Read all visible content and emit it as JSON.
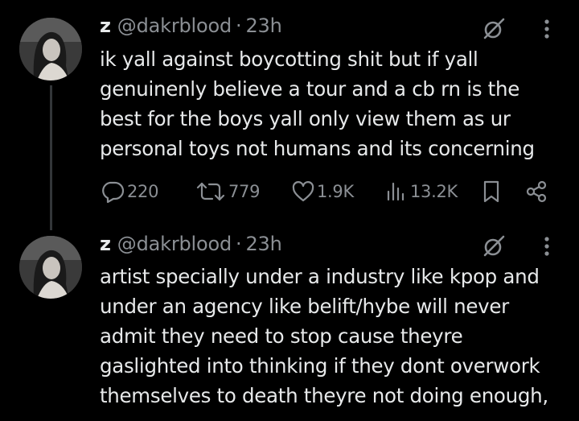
{
  "colors": {
    "background": "#000000",
    "text": "#e7e9ea",
    "secondary": "#8b8f94",
    "thread_line": "#333639"
  },
  "tweets": [
    {
      "name": "z",
      "handle": "@dakrblood",
      "separator": "·",
      "time": "23h",
      "avatar_icon": "profile-photo",
      "lines": [
        "ik yall against boycotting shit but if yall",
        "genuinenly believe a tour and a cb rn is the",
        "best for the boys yall only view them as ur",
        "personal toys not humans and its concerning"
      ],
      "actions": {
        "replies": "220",
        "retweets": "779",
        "likes": "1.9K",
        "views": "13.2K"
      }
    },
    {
      "name": "z",
      "handle": "@dakrblood",
      "separator": "·",
      "time": "23h",
      "avatar_icon": "profile-photo",
      "lines": [
        "artist specially under a industry like kpop and",
        "under an agency like belift/hybe will never",
        "admit they need to stop cause theyre",
        "gaslighted into thinking if they dont overwork",
        "themselves to death theyre not doing enough,"
      ]
    }
  ],
  "icons": {
    "grok": "grok-icon",
    "more": "more-icon",
    "reply": "reply-icon",
    "retweet": "retweet-icon",
    "like": "heart-icon",
    "views": "views-icon",
    "bookmark": "bookmark-icon",
    "share": "share-icon"
  }
}
